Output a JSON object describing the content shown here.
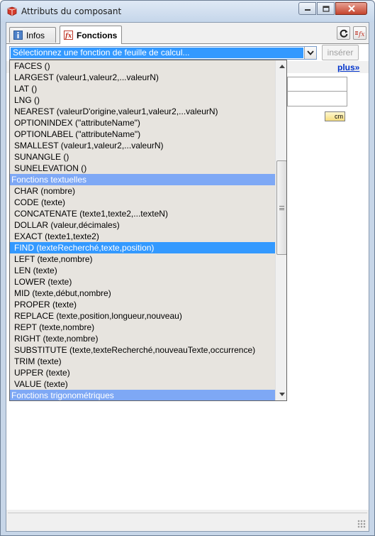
{
  "window": {
    "title": "Attributs du composant"
  },
  "tabs": [
    {
      "label": "Infos"
    },
    {
      "label": "Fonctions"
    }
  ],
  "toolbar": {
    "select_value": "Sélectionnez une fonction de feuille de calcul...",
    "insert_label": "insérer",
    "more_link": "plus»",
    "unit_field": "cm"
  },
  "dropdown": {
    "items": [
      {
        "label": "FACES ()",
        "kind": "item"
      },
      {
        "label": "LARGEST (valeur1,valeur2,...valeurN)",
        "kind": "item"
      },
      {
        "label": "LAT ()",
        "kind": "item"
      },
      {
        "label": "LNG ()",
        "kind": "item"
      },
      {
        "label": "NEAREST (valeurD'origine,valeur1,valeur2,...valeurN)",
        "kind": "item"
      },
      {
        "label": "OPTIONINDEX (\"attributeName\")",
        "kind": "item"
      },
      {
        "label": "OPTIONLABEL (\"attributeName\")",
        "kind": "item"
      },
      {
        "label": "SMALLEST (valeur1,valeur2,...valeurN)",
        "kind": "item"
      },
      {
        "label": "SUNANGLE ()",
        "kind": "item"
      },
      {
        "label": "SUNELEVATION ()",
        "kind": "item"
      },
      {
        "label": "Fonctions textuelles",
        "kind": "group"
      },
      {
        "label": "CHAR (nombre)",
        "kind": "item"
      },
      {
        "label": "CODE (texte)",
        "kind": "item"
      },
      {
        "label": "CONCATENATE (texte1,texte2,...texteN)",
        "kind": "item"
      },
      {
        "label": "DOLLAR (valeur,décimales)",
        "kind": "item"
      },
      {
        "label": "EXACT (texte1,texte2)",
        "kind": "item"
      },
      {
        "label": "FIND (texteRecherché,texte,position)",
        "kind": "selected"
      },
      {
        "label": "LEFT (texte,nombre)",
        "kind": "item"
      },
      {
        "label": "LEN (texte)",
        "kind": "item"
      },
      {
        "label": "LOWER (texte)",
        "kind": "item"
      },
      {
        "label": "MID (texte,début,nombre)",
        "kind": "item"
      },
      {
        "label": "PROPER (texte)",
        "kind": "item"
      },
      {
        "label": "REPLACE (texte,position,longueur,nouveau)",
        "kind": "item"
      },
      {
        "label": "REPT (texte,nombre)",
        "kind": "item"
      },
      {
        "label": "RIGHT (texte,nombre)",
        "kind": "item"
      },
      {
        "label": "SUBSTITUTE (texte,texteRecherché,nouveauTexte,occurrence)",
        "kind": "item"
      },
      {
        "label": "TRIM (texte)",
        "kind": "item"
      },
      {
        "label": "UPPER (texte)",
        "kind": "item"
      },
      {
        "label": "VALUE (texte)",
        "kind": "item"
      },
      {
        "label": "Fonctions trigonométriques",
        "kind": "group"
      }
    ]
  },
  "colors": {
    "selection": "#3399ff",
    "group_header": "#7ea8f5",
    "link": "#0033cc"
  }
}
